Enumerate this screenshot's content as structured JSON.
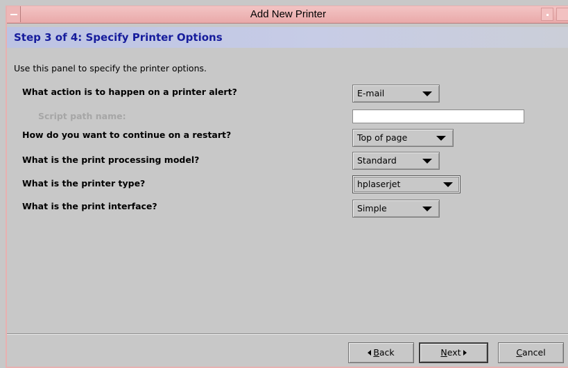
{
  "window": {
    "title": "Add New Printer"
  },
  "step": {
    "title": "Step 3 of 4: Specify Printer Options",
    "description": "Use this panel to specify the printer options."
  },
  "fields": {
    "alert": {
      "label": "What action is to happen on a printer alert?",
      "value": "E-mail"
    },
    "script_path": {
      "label": "Script path name:",
      "value": ""
    },
    "restart": {
      "label": "How do you want to continue on a restart?",
      "value": "Top of page"
    },
    "processing": {
      "label": "What is the print processing model?",
      "value": "Standard"
    },
    "printer_type": {
      "label": "What is the printer type?",
      "value": "hplaserjet"
    },
    "interface": {
      "label": "What is the print interface?",
      "value": "Simple"
    }
  },
  "buttons": {
    "back_prefix": "",
    "back_mnemonic": "B",
    "back_rest": "ack",
    "next_mnemonic": "N",
    "next_rest": "ext",
    "cancel_mnemonic": "C",
    "cancel_rest": "ancel"
  },
  "icons": {
    "window_menu": "window-menu-icon",
    "minimize": "minimize-icon",
    "maximize": "maximize-icon",
    "dropdown": "chevron-down-icon"
  },
  "colors": {
    "titlebar": "#e9a9a9",
    "step_title": "#161c9c",
    "background": "#c8c8c8"
  }
}
